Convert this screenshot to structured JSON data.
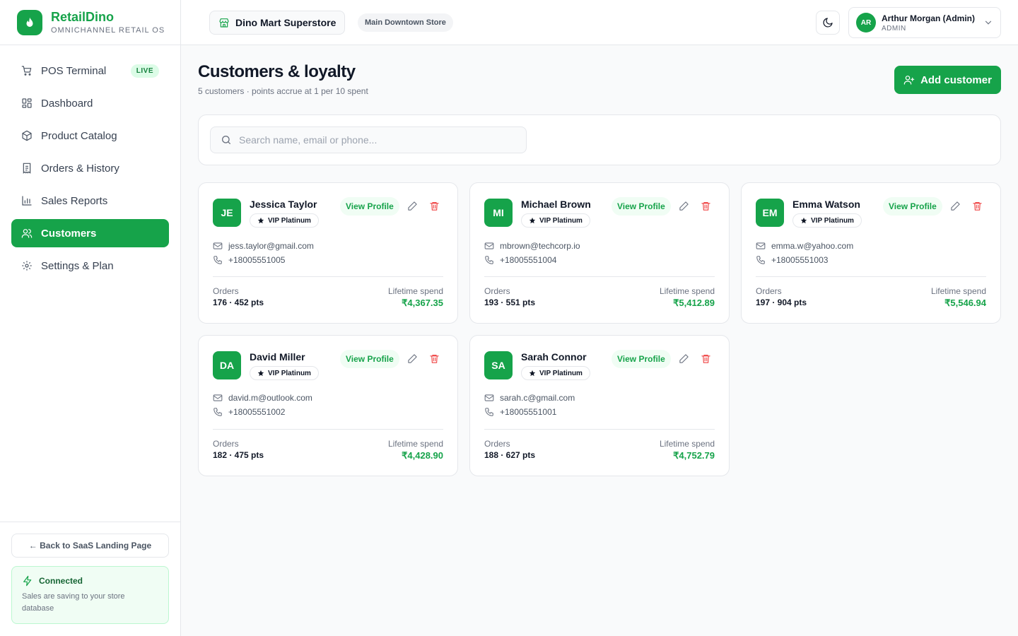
{
  "brand": {
    "name": "RetailDino",
    "tagline": "OMNICHANNEL RETAIL OS"
  },
  "sidebar": {
    "items": [
      {
        "label": "POS Terminal",
        "badge": "LIVE",
        "icon": "cart-icon"
      },
      {
        "label": "Dashboard",
        "icon": "grid-icon"
      },
      {
        "label": "Product Catalog",
        "icon": "package-icon"
      },
      {
        "label": "Orders & History",
        "icon": "receipt-icon"
      },
      {
        "label": "Sales Reports",
        "icon": "bar-chart-icon"
      },
      {
        "label": "Customers",
        "icon": "users-icon",
        "active": true
      },
      {
        "label": "Settings & Plan",
        "icon": "gear-icon"
      }
    ],
    "back_label": "← Back to SaaS Landing Page",
    "status": {
      "title": "Connected",
      "text": "Sales are saving to your store database"
    }
  },
  "header": {
    "store_name": "Dino Mart Superstore",
    "branch": "Main Downtown Store",
    "user": {
      "initials": "AR",
      "name": "Arthur Morgan (Admin)",
      "role": "ADMIN"
    }
  },
  "page": {
    "title": "Customers & loyalty",
    "subtitle": "5 customers · points accrue at 1 per 10 spent",
    "add_button": "Add customer",
    "search_placeholder": "Search name, email or phone..."
  },
  "labels": {
    "view_profile": "View Profile",
    "orders": "Orders",
    "lifetime_spend": "Lifetime spend"
  },
  "colors": {
    "accent": "#16a34a",
    "danger": "#ef4444"
  },
  "customers": [
    {
      "initials": "JE",
      "name": "Jessica Taylor",
      "tier": "VIP Platinum",
      "email": "jess.taylor@gmail.com",
      "phone": "+18005551005",
      "orders_points": "176 · 452 pts",
      "spend": "₹4,367.35"
    },
    {
      "initials": "MI",
      "name": "Michael Brown",
      "tier": "VIP Platinum",
      "email": "mbrown@techcorp.io",
      "phone": "+18005551004",
      "orders_points": "193 · 551 pts",
      "spend": "₹5,412.89"
    },
    {
      "initials": "EM",
      "name": "Emma Watson",
      "tier": "VIP Platinum",
      "email": "emma.w@yahoo.com",
      "phone": "+18005551003",
      "orders_points": "197 · 904 pts",
      "spend": "₹5,546.94"
    },
    {
      "initials": "DA",
      "name": "David Miller",
      "tier": "VIP Platinum",
      "email": "david.m@outlook.com",
      "phone": "+18005551002",
      "orders_points": "182 · 475 pts",
      "spend": "₹4,428.90"
    },
    {
      "initials": "SA",
      "name": "Sarah Connor",
      "tier": "VIP Platinum",
      "email": "sarah.c@gmail.com",
      "phone": "+18005551001",
      "orders_points": "188 · 627 pts",
      "spend": "₹4,752.79"
    }
  ]
}
